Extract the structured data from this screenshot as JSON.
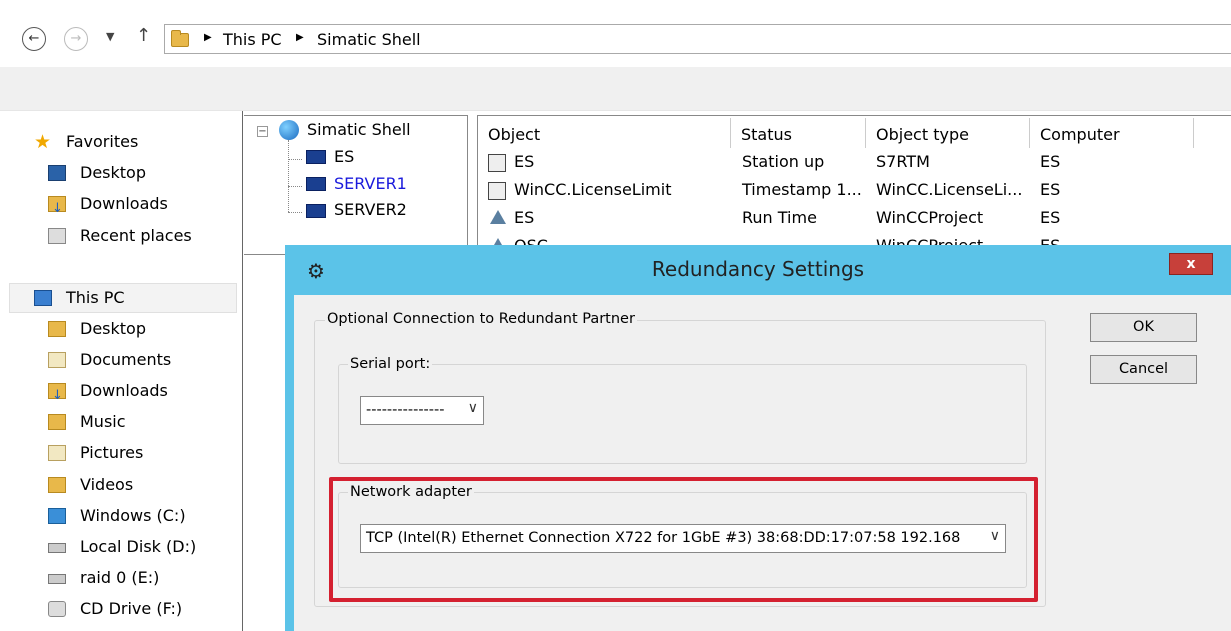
{
  "address_bar": {
    "back_icon": "back-arrow-icon",
    "forward_icon": "forward-arrow-icon",
    "recent_icon": "chevron-down-icon",
    "up_icon": "up-arrow-icon",
    "path": [
      "This PC",
      "Simatic Shell"
    ]
  },
  "nav_pane": {
    "favorites": {
      "label": "Favorites",
      "items": [
        {
          "label": "Desktop",
          "icon": "desktop-icon"
        },
        {
          "label": "Downloads",
          "icon": "downloads-icon"
        },
        {
          "label": "Recent places",
          "icon": "recent-places-icon"
        }
      ]
    },
    "this_pc": {
      "label": "This PC",
      "items": [
        {
          "label": "Desktop",
          "icon": "desktop-icon"
        },
        {
          "label": "Documents",
          "icon": "documents-icon"
        },
        {
          "label": "Downloads",
          "icon": "downloads-icon"
        },
        {
          "label": "Music",
          "icon": "music-icon"
        },
        {
          "label": "Pictures",
          "icon": "pictures-icon"
        },
        {
          "label": "Videos",
          "icon": "videos-icon"
        },
        {
          "label": "Windows (C:)",
          "icon": "windows-drive-icon"
        },
        {
          "label": "Local Disk (D:)",
          "icon": "local-disk-icon"
        },
        {
          "label": "raid 0 (E:)",
          "icon": "drive-icon"
        },
        {
          "label": "CD Drive (F:)",
          "icon": "cd-drive-icon"
        }
      ]
    }
  },
  "tree": {
    "root": "Simatic Shell",
    "children": [
      "ES",
      "SERVER1",
      "SERVER2"
    ],
    "link_color": "#1a1adc"
  },
  "list": {
    "columns": [
      "Object",
      "Status",
      "Object type",
      "Computer"
    ],
    "rows": [
      {
        "object": "ES",
        "status": "Station up",
        "type": "S7RTM",
        "computer": "ES"
      },
      {
        "object": "WinCC.LicenseLimit",
        "status": "Timestamp 1...",
        "type": "WinCC.LicenseLi...",
        "computer": "ES"
      },
      {
        "object": "ES",
        "status": "Run Time",
        "type": "WinCCProject",
        "computer": "ES"
      },
      {
        "object": "OSC",
        "status": "",
        "type": "WinCCProject",
        "computer": "ES"
      }
    ]
  },
  "dialog": {
    "title": "Redundancy Settings",
    "close_label": "x",
    "title_bar_color": "#5bc3e8",
    "group_label": "Optional Connection to Redundant Partner",
    "serial_port": {
      "label": "Serial port:",
      "value": "---------------"
    },
    "network_adapter": {
      "label": "Network adapter",
      "value": "TCP (Intel(R) Ethernet Connection X722 for 1GbE #3)   38:68:DD:17:07:58   192.168"
    },
    "ok_label": "OK",
    "cancel_label": "Cancel",
    "highlight_color": "#d42030"
  }
}
